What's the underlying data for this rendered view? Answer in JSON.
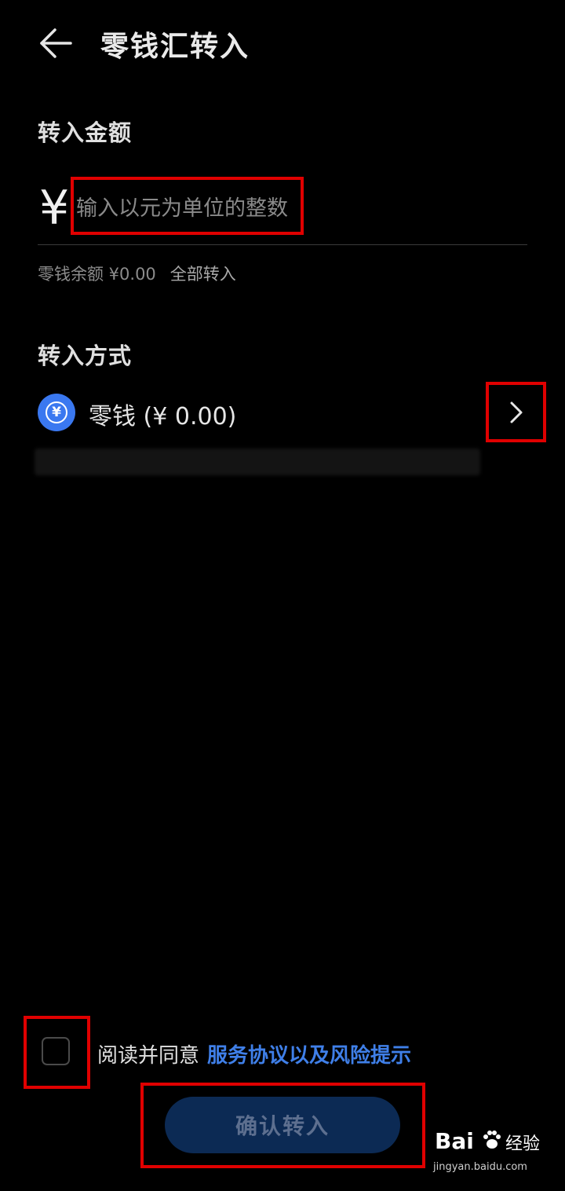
{
  "header": {
    "title": "零钱汇转入"
  },
  "amount_section": {
    "title": "转入金额",
    "currency_symbol": "¥",
    "input_placeholder": "输入以元为单位的整数",
    "balance_text": "零钱余额 ¥0.00",
    "transfer_all_label": "全部转入"
  },
  "method_section": {
    "title": "转入方式",
    "method_icon_symbol": "¥",
    "method_label": "零钱 (¥ 0.00)"
  },
  "agreement": {
    "prefix": "阅读并同意",
    "link_text": "服务协议以及风险提示",
    "checked": false
  },
  "confirm_button": {
    "label": "确认转入"
  },
  "watermark": {
    "brand": "Bai",
    "suffix": "经验",
    "url": "jingyan.baidu.com"
  },
  "colors": {
    "background": "#000000",
    "link": "#3f7fe8",
    "method_icon": "#3a78f0",
    "confirm_bg": "#0c2a54",
    "highlight": "#e00000"
  }
}
